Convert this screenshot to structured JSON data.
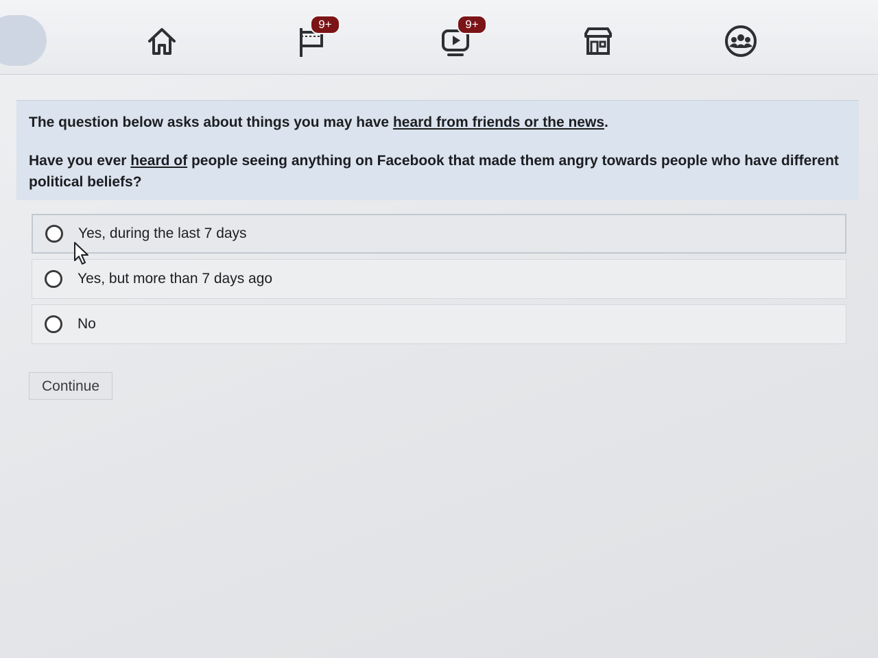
{
  "nav": {
    "tabs": [
      {
        "name": "home",
        "icon": "home-icon"
      },
      {
        "name": "pages",
        "icon": "flag-icon",
        "badge": "9+"
      },
      {
        "name": "watch",
        "icon": "video-icon",
        "badge": "9+"
      },
      {
        "name": "marketplace",
        "icon": "marketplace-icon"
      },
      {
        "name": "groups",
        "icon": "groups-icon"
      }
    ],
    "badge_color": "#7b1416"
  },
  "survey": {
    "intro_prefix": "The question below asks about things you may have ",
    "intro_link": "heard from friends or the news",
    "intro_suffix": ".",
    "question_prefix": "Have you ever ",
    "question_link": "heard of",
    "question_suffix": " people seeing anything on Facebook that made them angry towards people who have different political beliefs?",
    "options": [
      {
        "label": "Yes, during the last 7 days",
        "selected": false
      },
      {
        "label": "Yes, but more than 7 days ago",
        "selected": false
      },
      {
        "label": "No",
        "selected": false
      }
    ],
    "continue_label": "Continue"
  }
}
